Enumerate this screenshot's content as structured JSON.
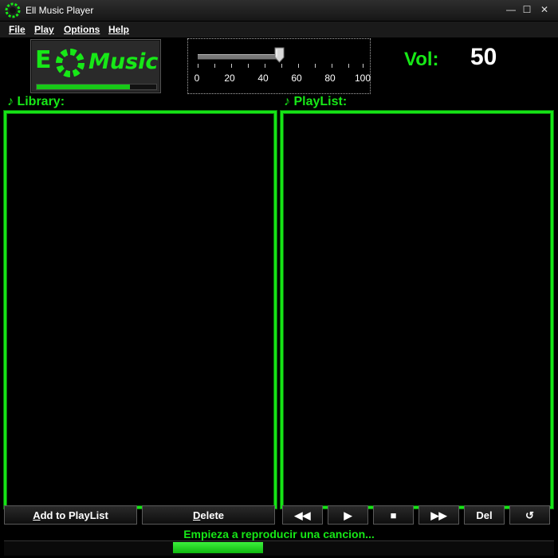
{
  "window": {
    "title": "Ell Music Player",
    "minimize_glyph": "—",
    "maximize_glyph": "☐",
    "close_glyph": "✕"
  },
  "menu": [
    "File",
    "Play",
    "Options",
    "Help"
  ],
  "logo": {
    "text_e": "E",
    "text_music": "Music",
    "progress": 0.78
  },
  "seek": {
    "position": 50,
    "ticks": [
      "0",
      "20",
      "40",
      "60",
      "80",
      "100"
    ]
  },
  "volume": {
    "label": "Vol:",
    "value": "50"
  },
  "library": {
    "label": "Library:",
    "note_icon": "♪"
  },
  "playlist": {
    "label": "PlayList:",
    "note_icon": "♪"
  },
  "buttons": {
    "add_to_playlist": {
      "accel": "A",
      "rest": "dd to PlayList"
    },
    "delete": {
      "accel": "D",
      "rest": "elete"
    },
    "rewind": "◀◀",
    "play": "▶",
    "stop": "■",
    "forward": "▶▶",
    "del": "Del",
    "repeat": "↺"
  },
  "status": {
    "text": "Empieza a reproducir una cancion...",
    "progress": 0.16
  },
  "colors": {
    "accent": "#17e817",
    "background": "#000000"
  }
}
